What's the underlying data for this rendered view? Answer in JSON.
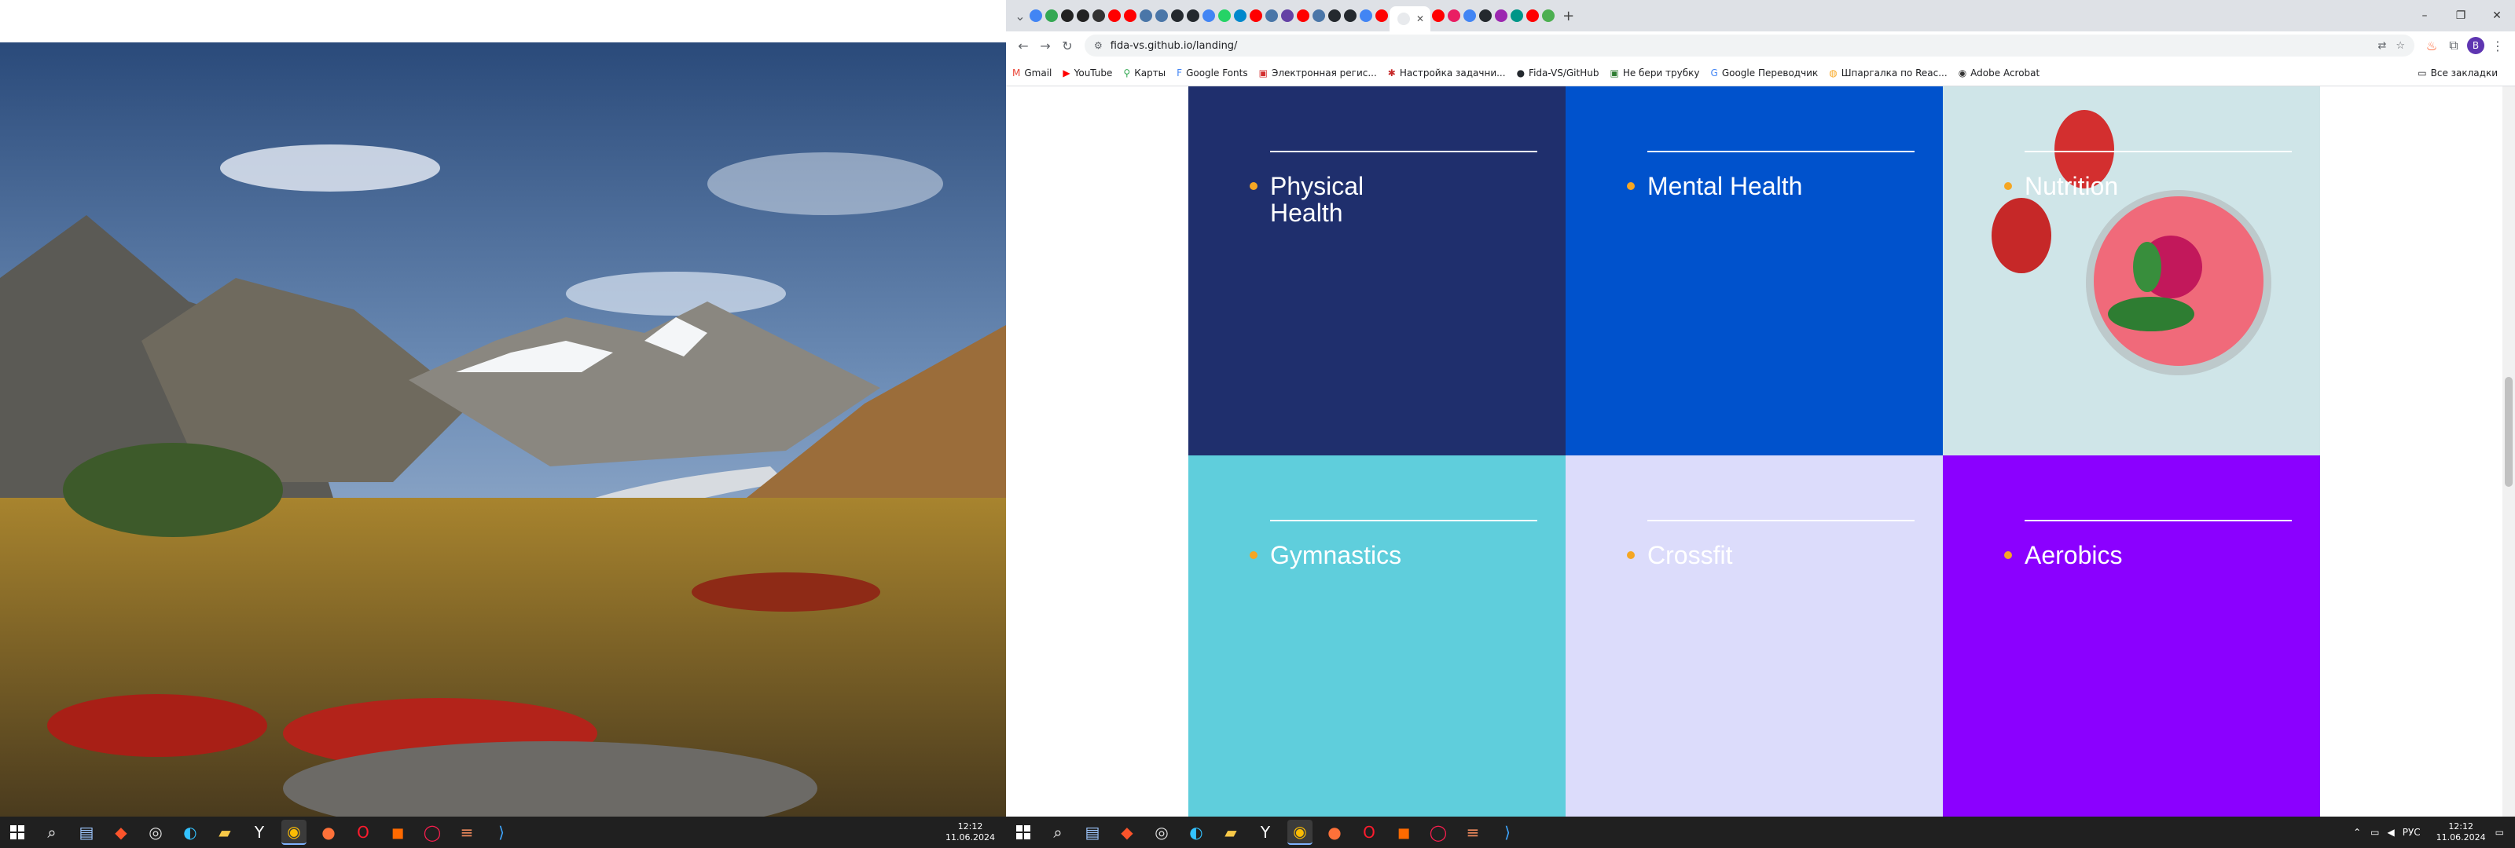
{
  "browser": {
    "url": "fida-vs.github.io/landing/",
    "window_controls": [
      "–",
      "❐",
      "✕"
    ],
    "new_tab": "+",
    "profile_initial": "В",
    "bookmarks": [
      {
        "label": "Gmail",
        "icon": "gmail-icon"
      },
      {
        "label": "YouTube",
        "icon": "youtube-icon"
      },
      {
        "label": "Карты",
        "icon": "maps-icon"
      },
      {
        "label": "Google Fonts",
        "icon": "fonts-icon"
      },
      {
        "label": "Электронная регис...",
        "icon": "registry-icon"
      },
      {
        "label": "Настройка задачни...",
        "icon": "task-icon"
      },
      {
        "label": "Fida-VS/GitHub",
        "icon": "github-icon"
      },
      {
        "label": "Не бери трубку",
        "icon": "phone-icon"
      },
      {
        "label": "Google Переводчик",
        "icon": "translate-icon"
      },
      {
        "label": "Шпаргалка по Reac...",
        "icon": "react-icon"
      },
      {
        "label": "Adobe Acrobat",
        "icon": "acrobat-icon"
      }
    ],
    "all_bookmarks": "Все закладки"
  },
  "cards": [
    {
      "title": "Physical Health",
      "color": "#1f2f6d",
      "image": false
    },
    {
      "title": "Mental Health",
      "color": "#0052cc",
      "image": false
    },
    {
      "title": "Nutrition",
      "color": "#cfe5e8",
      "image": true
    },
    {
      "title": "Gymnastics",
      "color": "#5fcedc",
      "image": false
    },
    {
      "title": "Crossfit",
      "color": "#dcdcfb",
      "image": false
    },
    {
      "title": "Aerobics",
      "color": "#8b00ff",
      "image": false
    }
  ],
  "taskbar_left": {
    "clock_time": "12:12",
    "clock_date": "11.06.2024"
  },
  "taskbar_right": {
    "clock_time": "12:12",
    "clock_date": "11.06.2024",
    "language": "РУС"
  }
}
